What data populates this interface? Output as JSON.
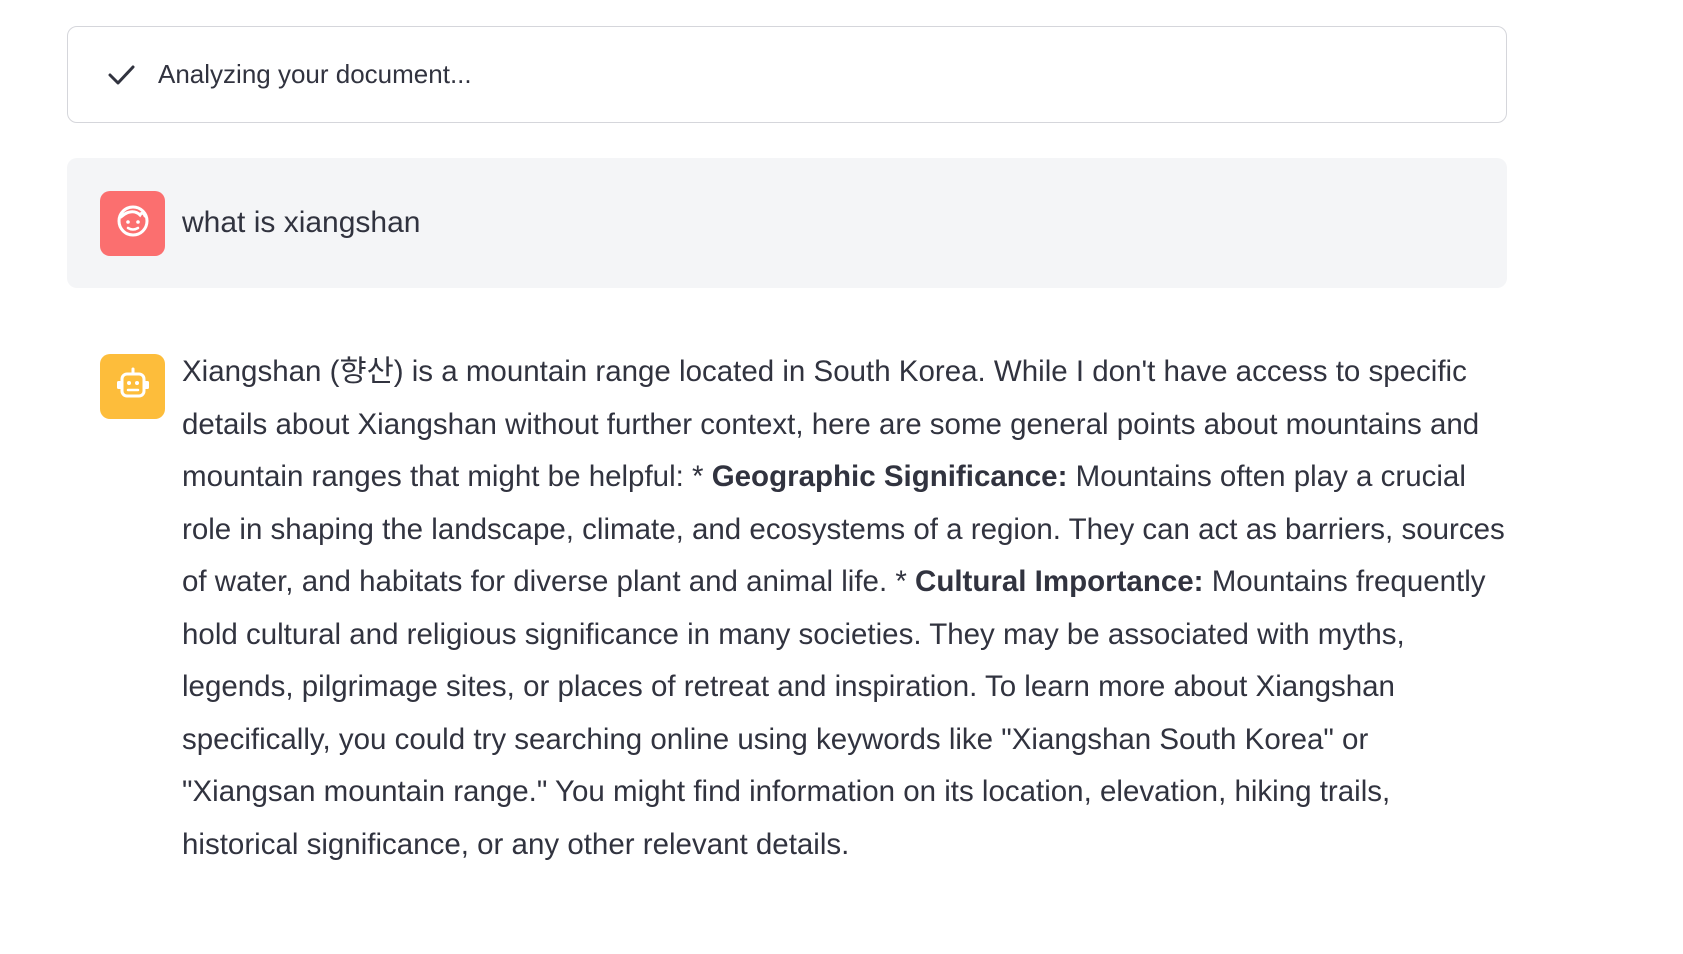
{
  "status": {
    "text": "Analyzing your document...",
    "icon": "check-icon"
  },
  "user_message": {
    "avatar_icon": "user-face-icon",
    "avatar_color": "#fb6f6f",
    "text": "what is xiangshan"
  },
  "assistant_message": {
    "avatar_icon": "robot-icon",
    "avatar_color": "#fdbd3b",
    "segments": [
      {
        "text": "Xiangshan (향산) is a mountain range located in South Korea. While I don't have access to specific details about Xiangshan without further context, here are some general points about mountains and mountain ranges that might be helpful: * ",
        "bold": false
      },
      {
        "text": "Geographic Significance:",
        "bold": true
      },
      {
        "text": " Mountains often play a crucial role in shaping the landscape, climate, and ecosystems of a region. They can act as barriers, sources of water, and habitats for diverse plant and animal life. * ",
        "bold": false
      },
      {
        "text": "Cultural Importance:",
        "bold": true
      },
      {
        "text": " Mountains frequently hold cultural and religious significance in many societies. They may be associated with myths, legends, pilgrimage sites, or places of retreat and inspiration. To learn more about Xiangshan specifically, you could try searching online using keywords like \"Xiangshan South Korea\" or \"Xiangsan mountain range.\" You might find information on its location, elevation, hiking trails, historical significance, or any other relevant details.",
        "bold": false
      }
    ]
  }
}
